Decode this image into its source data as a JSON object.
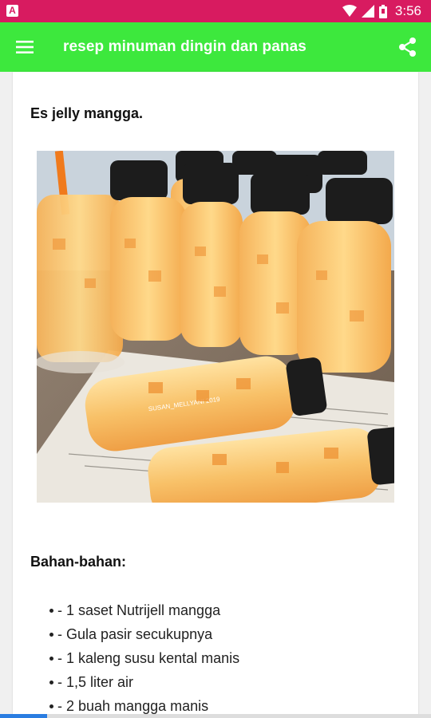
{
  "status_bar": {
    "time": "3:56",
    "notification_icon_letter": "A",
    "icons": [
      "wifi-icon",
      "signal-icon",
      "battery-icon"
    ],
    "bg_color": "#d81b60"
  },
  "app_bar": {
    "title": "resep minuman dingin dan panas",
    "menu_icon": "hamburger-menu-icon",
    "share_icon": "share-icon",
    "bg_color": "#3de83d"
  },
  "content": {
    "recipe_title": "Es jelly mangga.",
    "photo_watermark": "SUSAN_MELLYANI 2019",
    "ingredients_heading": "Bahan-bahan:",
    "ingredients": [
      "- 1 saset Nutrijell mangga",
      "- Gula pasir secukupnya",
      "- 1 kaleng susu kental manis",
      "- 1,5 liter air",
      "- 2 buah mangga manis"
    ]
  },
  "bottom_progress": {
    "fraction": 0.11,
    "color": "#2a7de1"
  }
}
